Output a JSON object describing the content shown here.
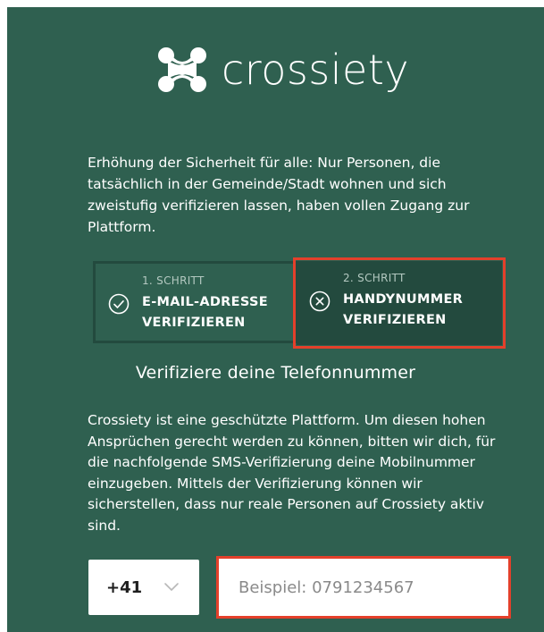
{
  "brand": {
    "name": "crossiety",
    "logo_color": "#ffffff"
  },
  "intro_text": "Erhöhung der Sicherheit für alle: Nur Personen, die tatsächlich in der Gemeinde/Stadt wohnen und sich zweistufig verifizieren lassen, haben vollen Zugang zur Plattform.",
  "steps": [
    {
      "kicker": "1. SCHRITT",
      "title": "E-MAIL-ADRESSE VERIFIZIEREN",
      "icon": "check-circle-icon",
      "state": "completed"
    },
    {
      "kicker": "2. SCHRITT",
      "title": "HANDYNUMMER VERIFIZIEREN",
      "icon": "x-circle-icon",
      "state": "active"
    }
  ],
  "verify_heading": "Verifiziere deine Telefonnummer",
  "info_text": "Crossiety ist eine geschützte Plattform. Um diesen hohen Ansprüchen gerecht werden zu können, bitten wir dich, für die nachfolgende SMS-Verifizierung deine Mobilnummer einzugeben. Mittels der Verifizierung können wir sicherstellen, dass nur reale Personen auf Crossiety aktiv sind.",
  "phone": {
    "country_code": "+41",
    "placeholder": "Beispiel: 0791234567",
    "value": ""
  },
  "colors": {
    "background": "#2f6050",
    "step_active": "#234a3e",
    "highlight": "#e4402b"
  }
}
